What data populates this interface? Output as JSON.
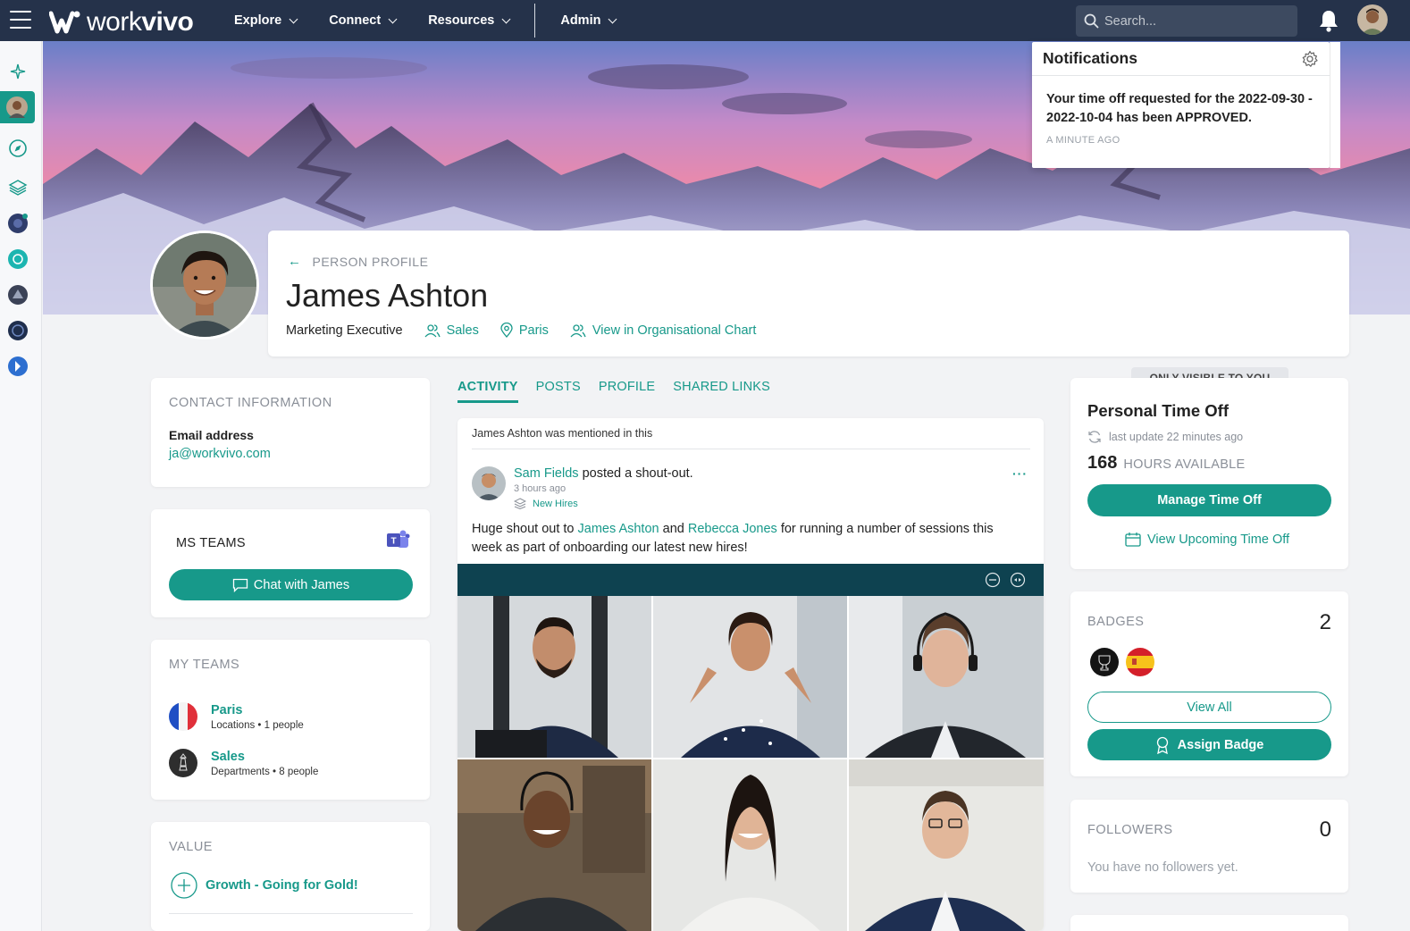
{
  "nav": {
    "logo_prefix": "work",
    "logo_suffix": "vivo",
    "items": [
      {
        "label": "Explore"
      },
      {
        "label": "Connect"
      },
      {
        "label": "Resources"
      },
      {
        "label": "Admin"
      }
    ],
    "search_placeholder": "Search..."
  },
  "notifications": {
    "title": "Notifications",
    "message": "Your time off requested for the 2022-09-30 - 2022-10-04 has been APPROVED.",
    "time": "A MINUTE AGO"
  },
  "profile": {
    "breadcrumb": "PERSON PROFILE",
    "name": "James Ashton",
    "role": "Marketing Executive",
    "department": "Sales",
    "location": "Paris",
    "org_chart_link": "View in Organisational Chart"
  },
  "contact": {
    "title": "CONTACT INFORMATION",
    "email_label": "Email address",
    "email": "ja@workvivo.com"
  },
  "ms_teams": {
    "title": "MS TEAMS",
    "button": "Chat with James"
  },
  "my_teams": {
    "title": "MY TEAMS",
    "teams": [
      {
        "name": "Paris",
        "meta": "Locations • 1 people"
      },
      {
        "name": "Sales",
        "meta": "Departments • 8 people"
      }
    ]
  },
  "value": {
    "title": "VALUE",
    "item": "Growth - Going for Gold!"
  },
  "tabs": [
    {
      "label": "ACTIVITY"
    },
    {
      "label": "POSTS"
    },
    {
      "label": "PROFILE"
    },
    {
      "label": "SHARED LINKS"
    }
  ],
  "post": {
    "context": "James Ashton was mentioned in this",
    "author": "Sam Fields",
    "action": "posted a shout-out.",
    "time": "3 hours ago",
    "space": "New Hires",
    "text_1": "Huge shout out to",
    "mention_1": "James Ashton",
    "text_2": "and",
    "mention_2": "Rebecca Jones",
    "text_3": "for running a number of sessions this week as part of onboarding our latest new hires!",
    "more": "···"
  },
  "time_off": {
    "visibility": "ONLY VISIBLE TO YOU",
    "title": "Personal Time Off",
    "last_update": "last update 22 minutes ago",
    "hours": "168",
    "hours_label": "HOURS AVAILABLE",
    "manage_button": "Manage Time Off",
    "upcoming_link": "View Upcoming Time Off"
  },
  "badges": {
    "title": "BADGES",
    "count": "2",
    "view_all": "View All",
    "assign": "Assign Badge"
  },
  "followers": {
    "title": "FOLLOWERS",
    "count": "0",
    "empty": "You have no followers yet."
  },
  "colors": {
    "accent": "#17998a",
    "nav_bg": "#25324a",
    "page_bg": "#f2f3f5"
  }
}
